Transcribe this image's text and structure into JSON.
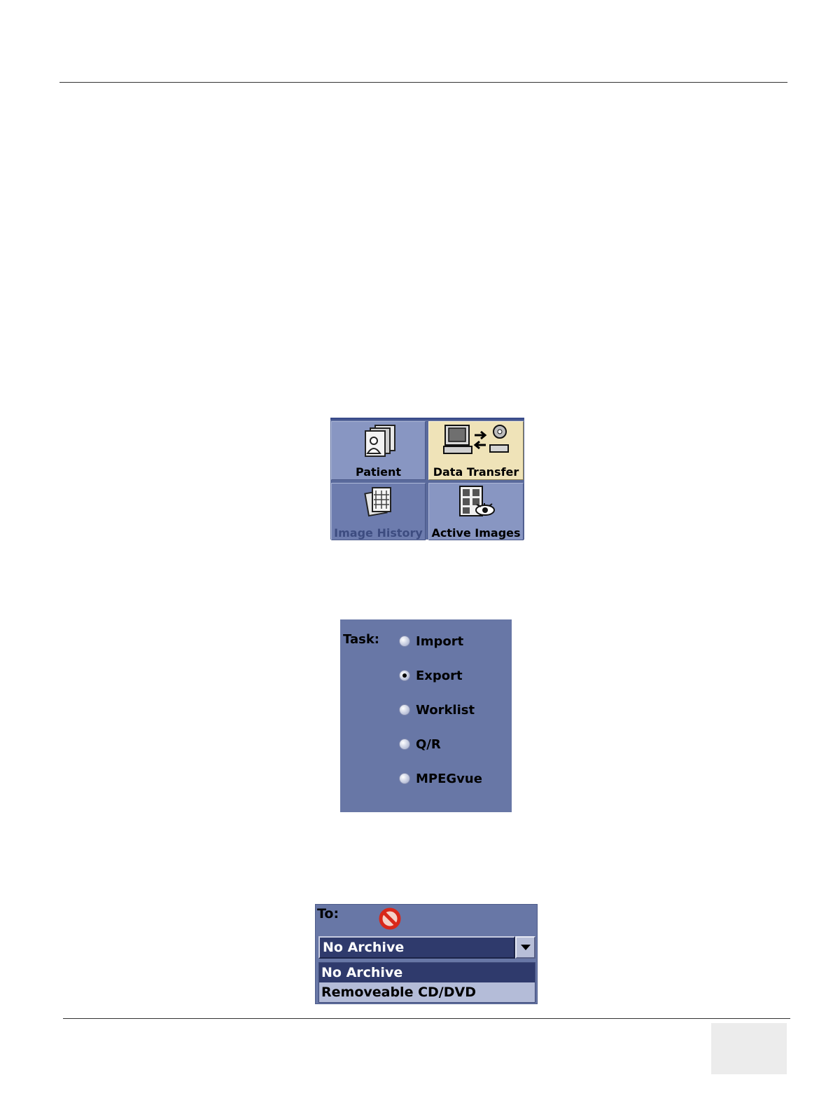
{
  "menu": {
    "tiles": [
      {
        "label": "Patient",
        "icon": "patient-folder-icon"
      },
      {
        "label": "Data Transfer",
        "icon": "data-transfer-icon",
        "active": true
      },
      {
        "label": "Image History",
        "icon": "image-history-icon",
        "disabled": true
      },
      {
        "label": "Active Images",
        "icon": "active-images-icon"
      }
    ]
  },
  "task": {
    "label": "Task:",
    "options": [
      {
        "label": "Import",
        "checked": false
      },
      {
        "label": "Export",
        "checked": true
      },
      {
        "label": "Worklist",
        "checked": false
      },
      {
        "label": "Q/R",
        "checked": false
      },
      {
        "label": "MPEGvue",
        "checked": false
      }
    ]
  },
  "destination": {
    "label": "To:",
    "status_icon": "no-entry-icon",
    "selected": "No Archive",
    "options": [
      "No Archive",
      "Removeable CD/DVD"
    ]
  },
  "colors": {
    "panel": "#6877a6",
    "tile": "#8896c2",
    "active_tile": "#efe3b8",
    "selection": "#2f3a6c"
  }
}
